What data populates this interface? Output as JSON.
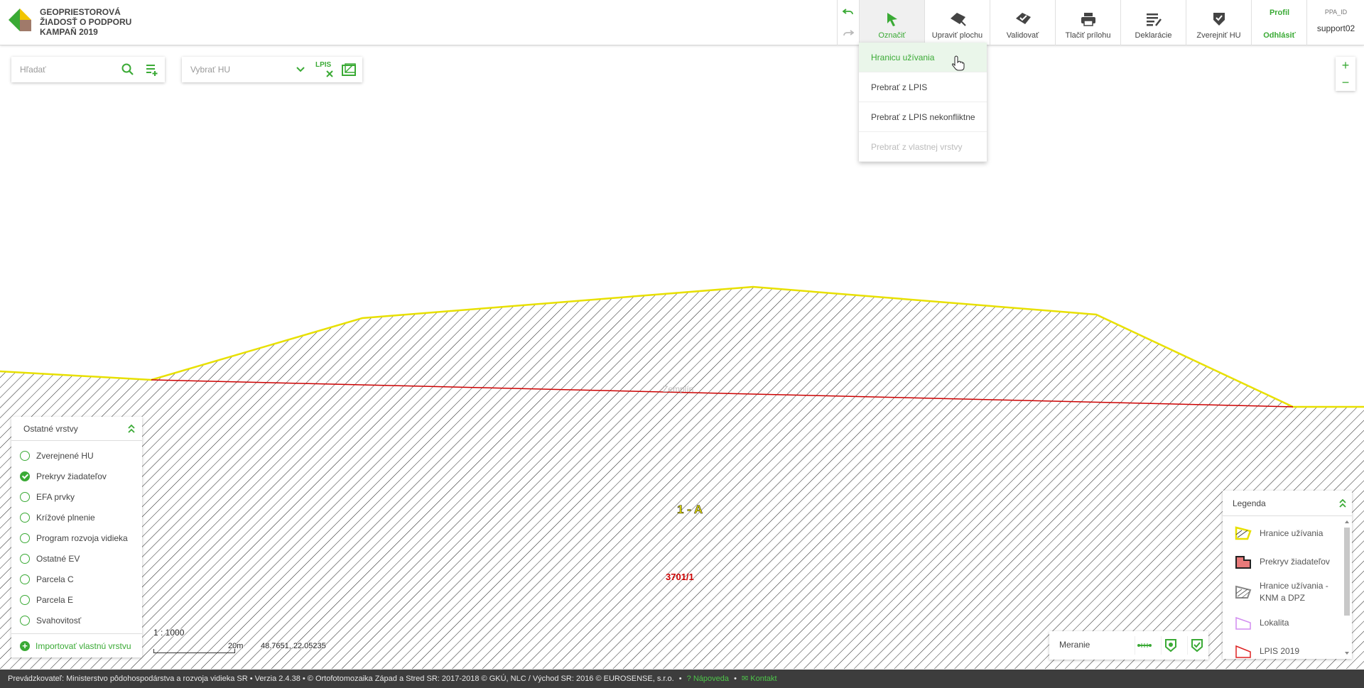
{
  "app": {
    "title_lines": [
      "GEOPRIESTOROVÁ",
      "ŽIADOSŤ O PODPORU",
      "KAMPAŇ 2019"
    ]
  },
  "toolbar": {
    "tools": [
      {
        "label": "Označiť",
        "icon": "cursor-arrow-icon",
        "active": true
      },
      {
        "label": "Upraviť plochu",
        "icon": "edit-polygon-icon"
      },
      {
        "label": "Validovať",
        "icon": "validate-polygon-icon"
      },
      {
        "label": "Tlačiť prílohu",
        "icon": "printer-icon"
      },
      {
        "label": "Deklarácie",
        "icon": "declarations-list-icon"
      },
      {
        "label": "Zverejniť HU",
        "icon": "publish-shield-icon"
      }
    ],
    "profile_label": "Profil",
    "logout_label": "Odhlásiť",
    "ppa_label": "PPA_ID",
    "username": "support02"
  },
  "dropdown": {
    "items": [
      {
        "label": "Hranicu užívania",
        "state": "hover"
      },
      {
        "label": "Prebrať z LPIS",
        "state": "normal"
      },
      {
        "label": "Prebrať z LPIS nekonfliktne",
        "state": "normal"
      },
      {
        "label": "Prebrať z vlastnej vrstvy",
        "state": "disabled"
      }
    ]
  },
  "search": {
    "placeholder": "Hľadať"
  },
  "hu_select": {
    "placeholder": "Vybrať HU",
    "lpis_label": "LPIS"
  },
  "layers": {
    "title": "Ostatné vrstvy",
    "items": [
      {
        "label": "Zverejnené HU",
        "checked": false
      },
      {
        "label": "Prekryv žiadateľov",
        "checked": true
      },
      {
        "label": "EFA prvky",
        "checked": false
      },
      {
        "label": "Krížové plnenie",
        "checked": false
      },
      {
        "label": "Program rozvoja vidieka",
        "checked": false
      },
      {
        "label": "Ostatné EV",
        "checked": false
      },
      {
        "label": "Parcela C",
        "checked": false
      },
      {
        "label": "Parcela E",
        "checked": false
      },
      {
        "label": "Svahovitosť",
        "checked": false
      }
    ],
    "import_label": "Importovať vlastnú vrstvu"
  },
  "map": {
    "labels": {
      "block": "1 - A",
      "parcel": "3701/1",
      "faint": "Zemplín"
    },
    "colors": {
      "boundary": "#e8e000",
      "overlap": "#cc0000",
      "hatch": "#222222",
      "accent": "#3aaa35"
    }
  },
  "scale": {
    "ratio": "1 : 1000",
    "distance": "20m",
    "coords": "48.7651, 22.05235"
  },
  "measure": {
    "label": "Meranie"
  },
  "legend": {
    "title": "Legenda",
    "items": [
      {
        "label": "Hranice užívania"
      },
      {
        "label": "Prekryv žiadateľov"
      },
      {
        "label": "Hranice užívania - KNM a DPZ"
      },
      {
        "label": "Lokalita"
      },
      {
        "label": "LPIS 2019"
      }
    ]
  },
  "footer": {
    "text": "Prevádzkovateľ: Ministerstvo pôdohospodárstva a rozvoja vidieka SR • Verzia 2.4.38 • © Ortofotomozaika Západ a Stred SR: 2017-2018 © GKÚ, NLC / Východ SR: 2016 © EUROSENSE, s.r.o.",
    "help_label": "Nápoveda",
    "contact_label": "Kontakt"
  }
}
